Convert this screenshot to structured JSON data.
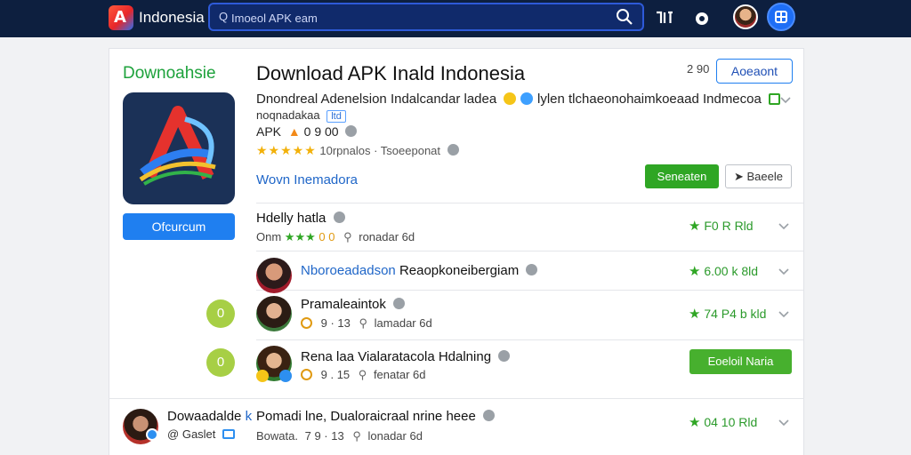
{
  "topbar": {
    "brand_letter": "A",
    "brand_name": "Indonesia",
    "search_lead": "Q",
    "search_text": "Imoeol APK eam",
    "icons": [
      "search-icon",
      "tools-icon",
      "record-icon",
      "avatar",
      "globe-icon"
    ]
  },
  "sidebar": {
    "title": "Downoahsie",
    "main_button": "Ofcurcum"
  },
  "header": {
    "title": "Download APK Inald Indonesia",
    "price": "2 90",
    "accent_button": "Aoeaont"
  },
  "details": {
    "description": "Dnondreal Adenelsion Indalcandar ladea",
    "description_right": "lylen tlchaeonohaimkoeaad Indmecoa",
    "meta_text": "noqnadakaa",
    "meta_tag": "ltd",
    "apk_label": "APK",
    "apk_counts": "0  9  00",
    "stars": "★★★★★",
    "rating_text": "10rpnalos · Tsoeeponat",
    "link": "Wovn Inemadora",
    "green_button": "Seneaten",
    "ghost_button": "Baeele"
  },
  "rows": [
    {
      "title": "Hdelly hatla",
      "sub_lead": "Onm",
      "sub_stars": "★★★",
      "sub_counts": "0 0",
      "sub_tail": "ronadar 6d",
      "rating": "F0 R Rld"
    },
    {
      "title_blue": "Nboroeadadson",
      "title": "Reaopkoneibergiam",
      "rating": "6.00 k 8ld"
    },
    {
      "badge": "0",
      "title": "Pramaleaintok",
      "sub_counts": "9 · 13",
      "sub_tail": "lamadar 6d",
      "rating": "74 P4 b kld"
    },
    {
      "badge": "0",
      "title": "Rena laa Vialaratacola Hdalning",
      "sub_counts": "9 . 15",
      "sub_tail": "fenatar 6d",
      "button": "Eoeloil Naria"
    },
    {
      "name": "Dowaadalde",
      "name_suffix": "k",
      "title": "Pomadi lne, Dualoraicraal nrine heee",
      "name_sub_lead": "@",
      "name_sub": "Gaslet",
      "sub_lead": "Bowata.",
      "sub_counts": "7  9 · 13",
      "sub_tail": "lonadar 6d",
      "rating": "04 10 Rld"
    }
  ],
  "colors": {
    "topbar": "#0d1f3f",
    "accent_blue": "#1f7ff0",
    "green": "#2fa624",
    "star_gold": "#f2b10a"
  }
}
